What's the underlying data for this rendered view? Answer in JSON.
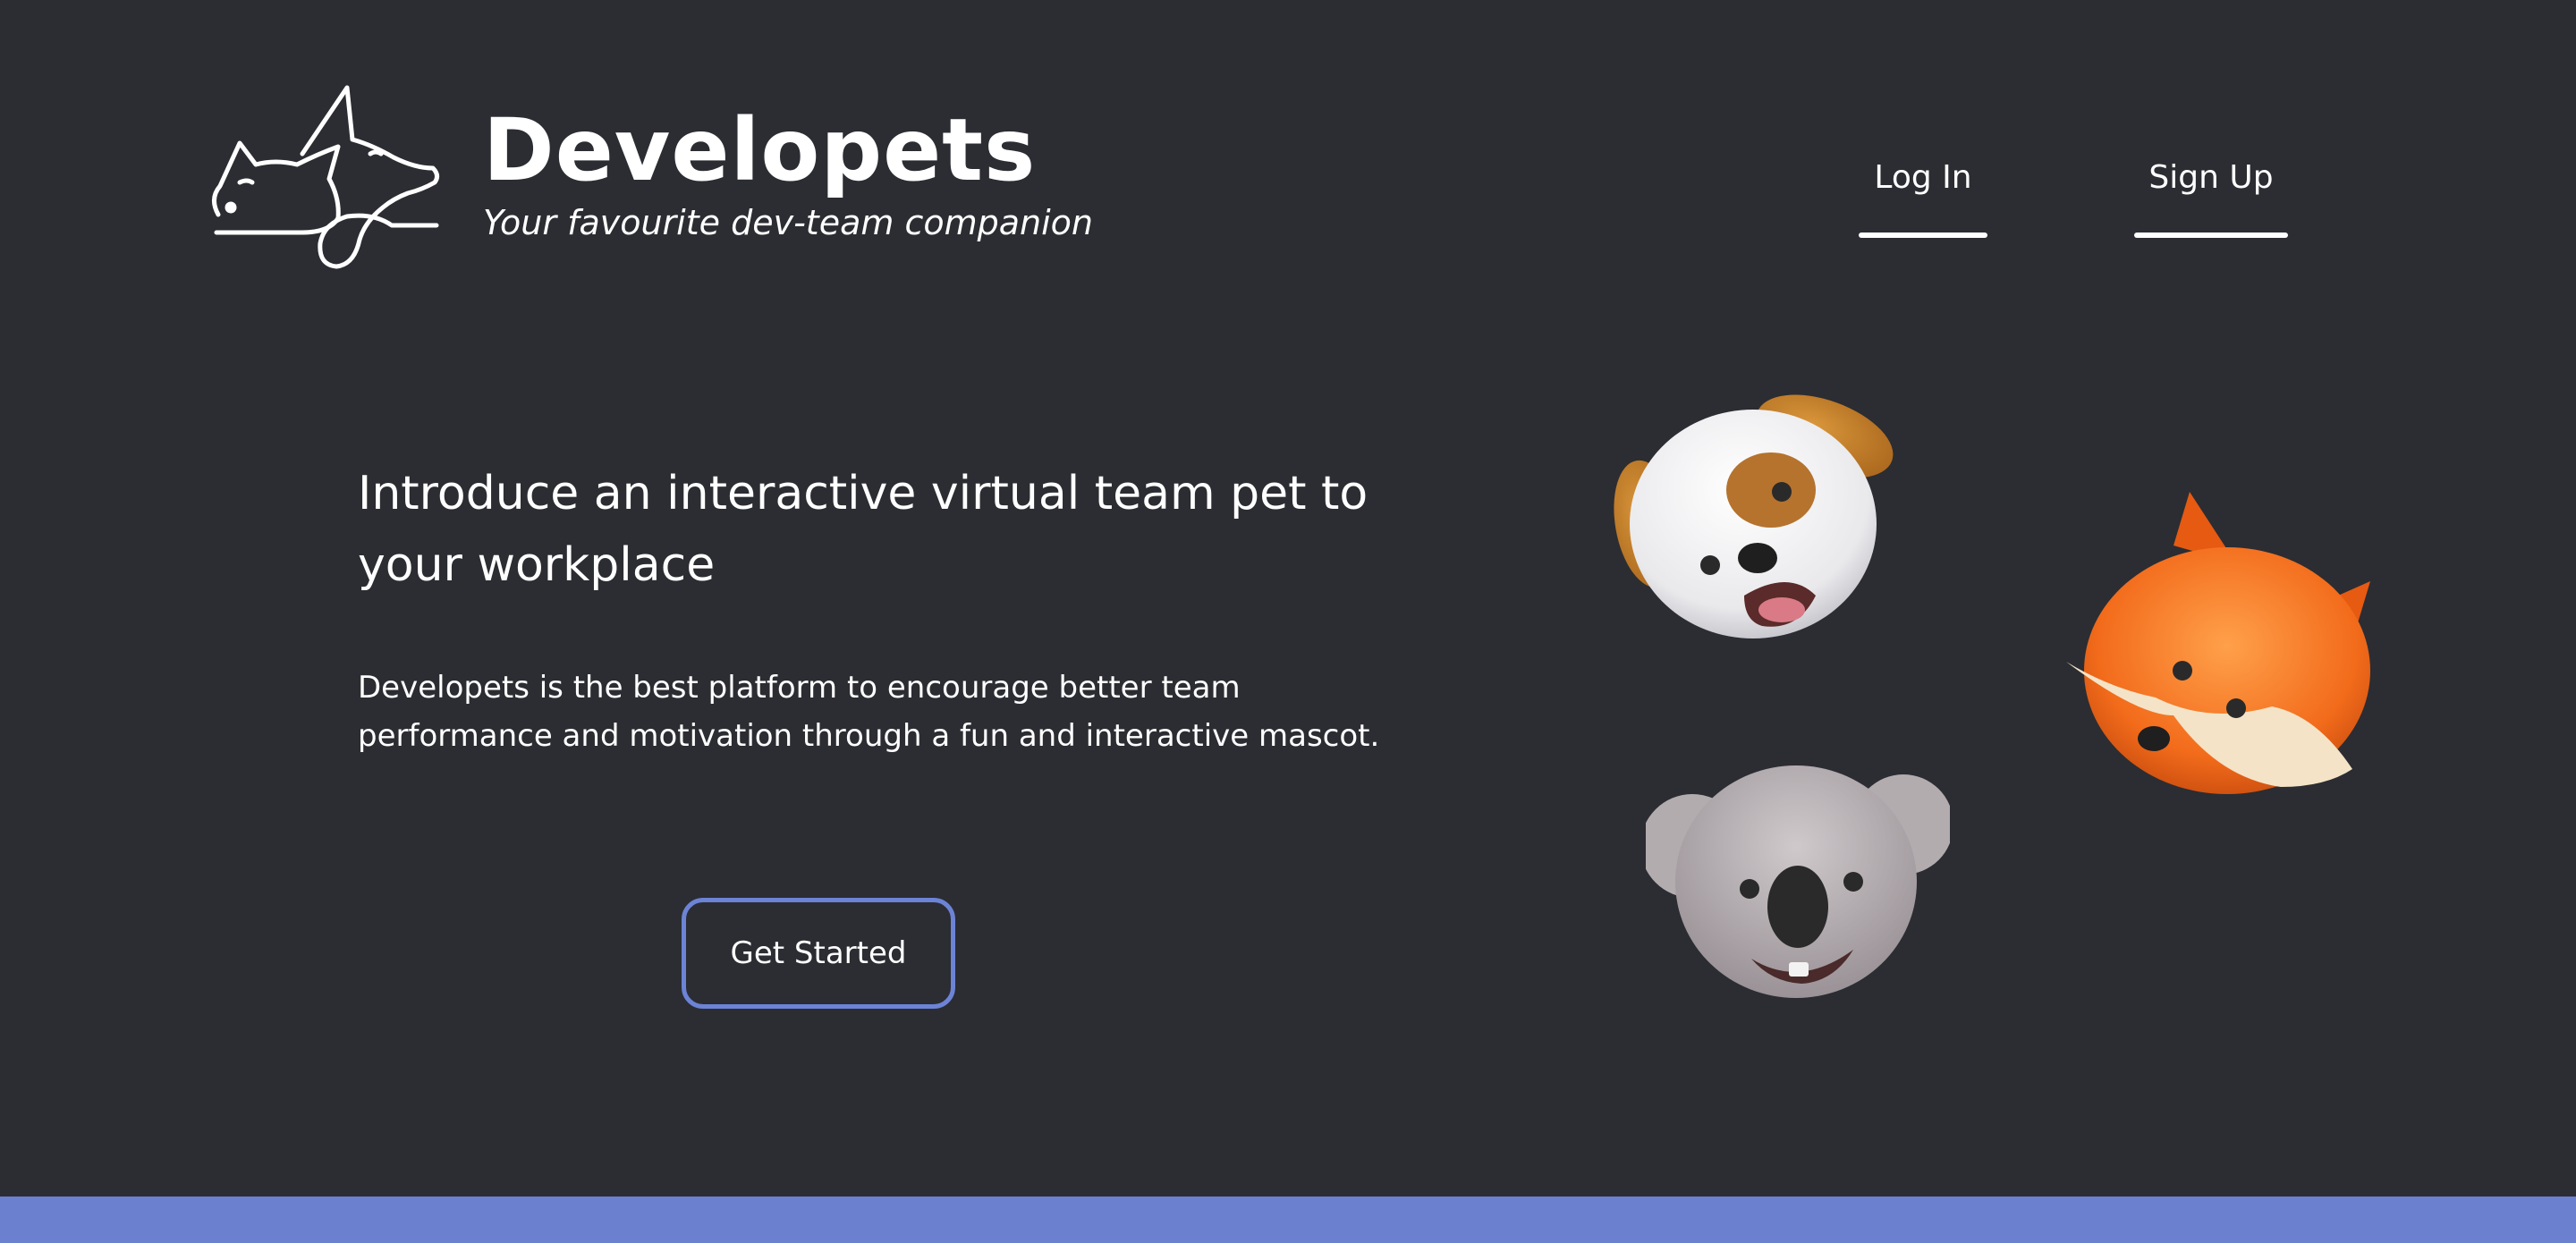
{
  "header": {
    "brand_name": "Developets",
    "tagline": "Your favourite dev-team companion",
    "logo_icon": "cat-and-dog-line-logo",
    "nav": {
      "login_label": "Log In",
      "signup_label": "Sign Up"
    }
  },
  "hero": {
    "heading": "Introduce an interactive virtual team pet to your workplace",
    "body": "Developets is the best platform to encourage better team performance and motivation through a fun and interactive mascot.",
    "cta_label": "Get Started"
  },
  "mascots": [
    "dog",
    "fox",
    "koala"
  ],
  "colors": {
    "background": "#2b2d32",
    "accent": "#6c83d6",
    "bottom_bar": "#6b80cf",
    "text": "#ffffff"
  }
}
